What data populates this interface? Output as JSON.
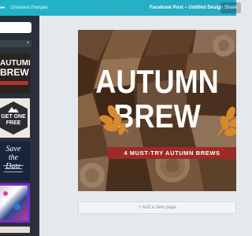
{
  "topbar": {
    "menu_glyph": "⬅",
    "unsaved": "Unsaved changes",
    "title": "Facebook Post – Untitled Design",
    "share_label": "Share"
  },
  "sidebar": {
    "search": {
      "value": "",
      "placeholder": ""
    },
    "templates": [
      {
        "name": "autumn-brew-template",
        "line1": "AUTUMN",
        "line2": "BREW"
      },
      {
        "name": "get-one-free-template",
        "line1": "GET ONE",
        "line2": "FREE"
      },
      {
        "name": "save-the-date-template",
        "line1": "Save",
        "line2": "the Date"
      },
      {
        "name": "photo-collage-template"
      },
      {
        "name": "partial-template"
      }
    ]
  },
  "design": {
    "headline_line1": "AUTUMN",
    "headline_line2": "BREW",
    "banner": "4 MUST-TRY AUTUMN BREWS"
  },
  "add_page_label": "+ Add a new page",
  "colors": {
    "topbar": "#1fb3c8",
    "sidebar": "#293039",
    "banner": "#9d2b25",
    "leaf": "#d8892b",
    "canvas_bg": "#e6e9ec"
  }
}
